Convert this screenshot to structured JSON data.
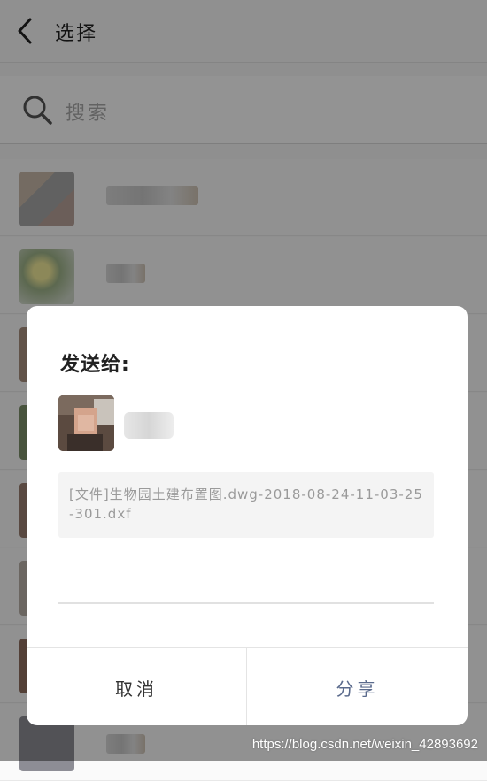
{
  "header": {
    "title": "选择",
    "back_icon": "chevron-left-icon"
  },
  "search": {
    "placeholder": "搜索",
    "icon": "search-icon"
  },
  "dialog": {
    "title": "发送给:",
    "message": "[文件]生物园土建布置图.dwg-2018-08-24-11-03-25-301.dxf",
    "cancel_label": "取消",
    "share_label": "分享",
    "share_color": "#5a6a8c"
  },
  "watermark": "https://blog.csdn.net/weixin_42893692"
}
